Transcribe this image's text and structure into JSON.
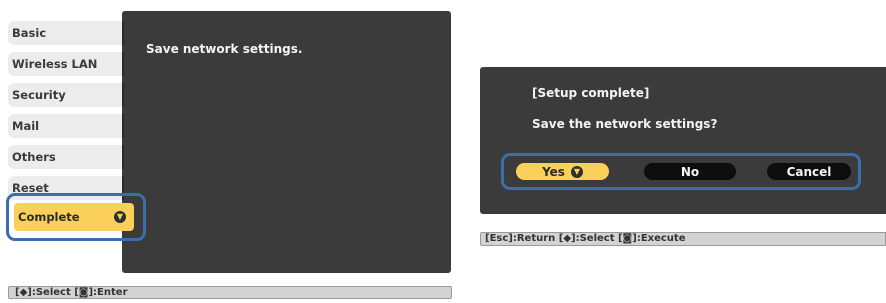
{
  "menu": {
    "tabs": [
      "Basic",
      "Wireless LAN",
      "Security",
      "Mail",
      "Others",
      "Reset"
    ],
    "selected_tab": "Complete",
    "message": "Save network settings.",
    "status_bar": "[◆]:Select  [◙]:Enter"
  },
  "dialog": {
    "title": "[Setup complete]",
    "message": "Save the network settings?",
    "buttons": {
      "yes": "Yes",
      "no": "No",
      "cancel": "Cancel"
    },
    "status_bar": "[Esc]:Return  [◆]:Select  [◙]:Execute"
  },
  "icons": {
    "enter": "enter-icon"
  },
  "colors": {
    "panel": "#3b3b3b",
    "highlight": "#fad05a",
    "callout": "#3a6faa"
  }
}
